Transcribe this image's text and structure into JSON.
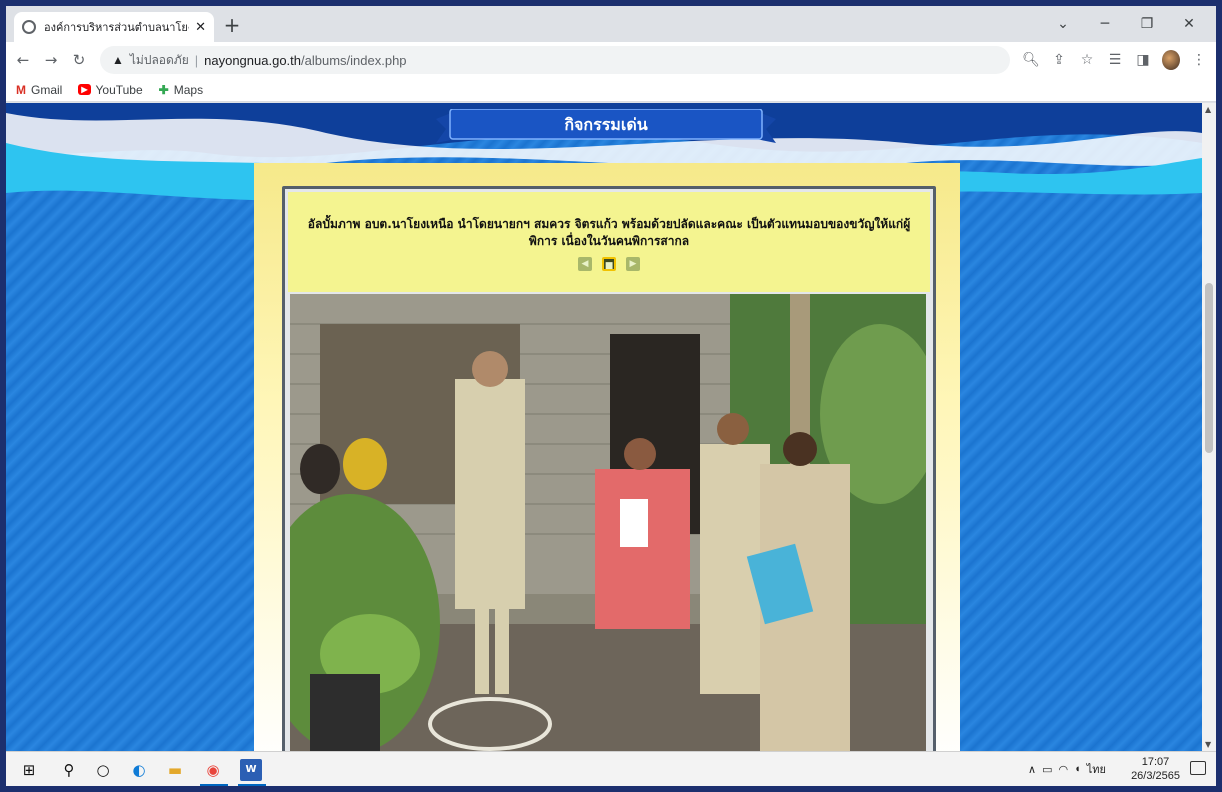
{
  "browser": {
    "tab_title": "องค์การบริหารส่วนตำบลนาโยงเหนือ ห",
    "new_tab_label": "+",
    "not_secure_label": "ไม่ปลอดภัย",
    "url_host": "nayongnua.go.th",
    "url_path": "/albums/index.php",
    "bookmarks": [
      {
        "label": "Gmail",
        "icon": "gmail-icon"
      },
      {
        "label": "YouTube",
        "icon": "youtube-icon"
      },
      {
        "label": "Maps",
        "icon": "maps-icon"
      }
    ]
  },
  "page": {
    "section_title": "กิจกรรมเด่น",
    "album_caption": "อัลบั้มภาพ อบต.นาโยงเหนือ นำโดยนายกฯ สมควร จิตรแก้ว พร้อมด้วยปลัดและคณะ เป็นตัวแทนมอบของขวัญให้แก่ผู้พิการ เนื่องในวันคนพิการสากล",
    "current_page_indicator": "■"
  },
  "taskbar": {
    "language": "ไทย",
    "time": "17:07",
    "date": "26/3/2565"
  },
  "colors": {
    "page_background": "#1b74d0",
    "ribbon": "#1446a8",
    "caption_background": "#f4f490"
  }
}
